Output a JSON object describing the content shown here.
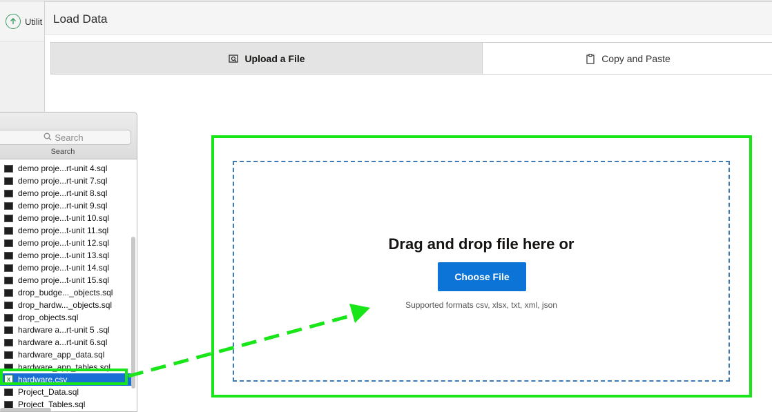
{
  "background": {
    "utility_label": "Utilit"
  },
  "dialog": {
    "title": "Load Data",
    "tabs": [
      {
        "label": "Upload a File",
        "icon": "upload-file-icon",
        "active": true
      },
      {
        "label": "Copy and Paste",
        "icon": "clipboard-icon",
        "active": false
      }
    ],
    "dropzone": {
      "heading": "Drag and drop file here or",
      "button_label": "Choose File",
      "formats_text": "Supported formats csv, xlsx, txt, xml, json"
    }
  },
  "finder": {
    "search_placeholder": "Search",
    "search_label": "Search",
    "files": [
      {
        "name": "demo proje...rt-unit 4.sql",
        "icon": "sql-file-icon"
      },
      {
        "name": "demo proje...rt-unit 7.sql",
        "icon": "sql-file-icon"
      },
      {
        "name": "demo proje...rt-unit 8.sql",
        "icon": "sql-file-icon"
      },
      {
        "name": "demo proje...rt-unit 9.sql",
        "icon": "sql-file-icon"
      },
      {
        "name": "demo proje...t-unit 10.sql",
        "icon": "sql-file-icon"
      },
      {
        "name": "demo proje...t-unit 11.sql",
        "icon": "sql-file-icon"
      },
      {
        "name": "demo proje...t-unit 12.sql",
        "icon": "sql-file-icon"
      },
      {
        "name": "demo proje...t-unit 13.sql",
        "icon": "sql-file-icon"
      },
      {
        "name": "demo proje...t-unit 14.sql",
        "icon": "sql-file-icon"
      },
      {
        "name": "demo proje...t-unit 15.sql",
        "icon": "sql-file-icon"
      },
      {
        "name": "drop_budge..._objects.sql",
        "icon": "sql-file-icon"
      },
      {
        "name": "drop_hardw..._objects.sql",
        "icon": "sql-file-icon"
      },
      {
        "name": "drop_objects.sql",
        "icon": "sql-file-icon"
      },
      {
        "name": "hardware a...rt-unit 5 .sql",
        "icon": "sql-file-icon"
      },
      {
        "name": "hardware a...rt-unit 6.sql",
        "icon": "sql-file-icon"
      },
      {
        "name": "hardware_app_data.sql",
        "icon": "sql-file-icon"
      },
      {
        "name": "hardware_app_tables.sql",
        "icon": "sql-file-icon"
      },
      {
        "name": "hardware.csv",
        "icon": "excel-file-icon",
        "selected": true
      },
      {
        "name": "Project_Data.sql",
        "icon": "sql-file-icon"
      },
      {
        "name": "Project_Tables.sql",
        "icon": "sql-file-icon"
      }
    ]
  },
  "colors": {
    "highlight": "#19e619",
    "primary_button": "#0b74d6",
    "selection": "#1a6fd6",
    "dropzone_border": "#3a7ab8"
  }
}
